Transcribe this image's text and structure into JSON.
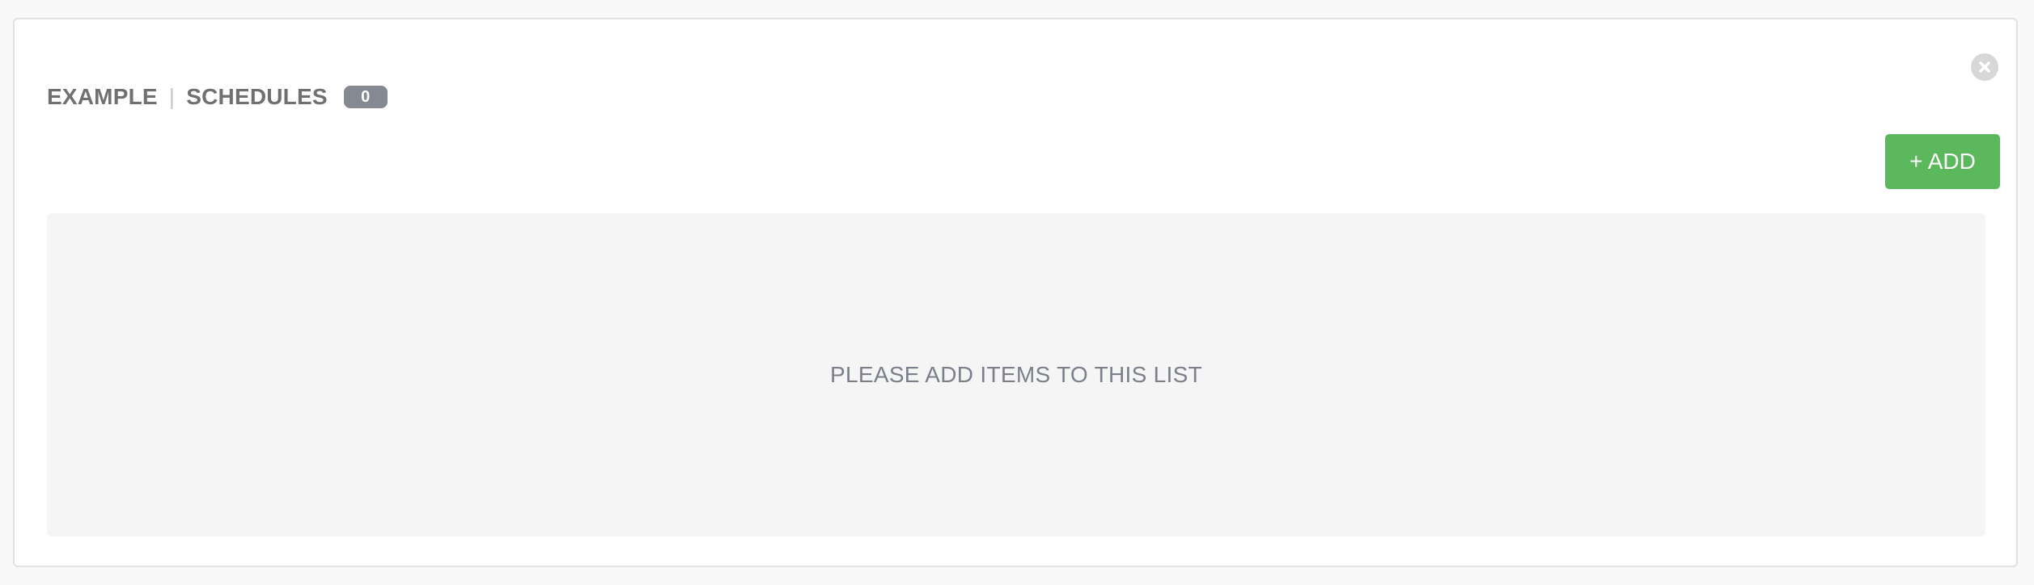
{
  "header": {
    "resource_name": "EXAMPLE",
    "divider": "|",
    "section_title": "SCHEDULES",
    "count": "0"
  },
  "toolbar": {
    "add_label": "+ ADD"
  },
  "list": {
    "empty_message": "PLEASE ADD ITEMS TO THIS LIST"
  },
  "colors": {
    "add_button": "#5cb85c",
    "badge": "#848992",
    "empty_bg": "#f5f5f5"
  },
  "icons": {
    "close": "close-icon"
  }
}
